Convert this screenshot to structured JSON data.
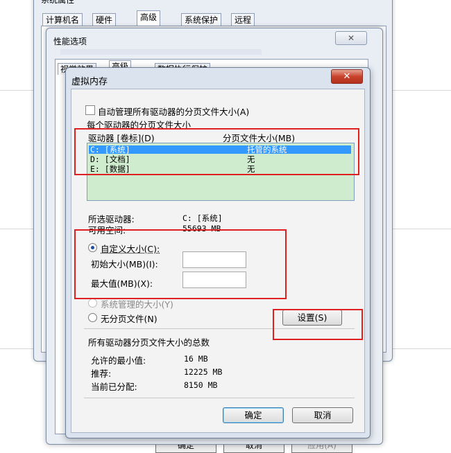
{
  "system_properties": {
    "title": "系统属性",
    "tabs": [
      "计算机名",
      "硬件",
      "高级",
      "系统保护",
      "远程"
    ],
    "buttons": {
      "ok": "确定",
      "cancel": "取消",
      "apply": "应用(A)"
    }
  },
  "performance_options": {
    "title": "性能选项",
    "tabs": [
      "视觉效果",
      "高级",
      "数据执行保护"
    ]
  },
  "virtual_memory": {
    "title": "虚拟内存",
    "close_glyph": "✕",
    "auto_manage_label": "自动管理所有驱动器的分页文件大小(A)",
    "section_label": "每个驱动器的分页文件大小",
    "list_headers": {
      "drive": "驱动器 [卷标](D)",
      "size": "分页文件大小(MB)"
    },
    "drives": [
      {
        "drive": "C:   [系统]",
        "size": "托管的系统",
        "selected": true
      },
      {
        "drive": "D:   [文档]",
        "size": "无",
        "selected": false
      },
      {
        "drive": "E:   [数据]",
        "size": "无",
        "selected": false
      }
    ],
    "selected_drive_label": "所选驱动器:",
    "selected_drive_value": "C:  [系统]",
    "free_space_label": "可用空间:",
    "free_space_value": "55693 MB",
    "custom_size_label": "自定义大小(C):",
    "initial_size_label": "初始大小(MB)(I):",
    "initial_size_value": "",
    "max_size_label": "最大值(MB)(X):",
    "max_size_value": "",
    "system_managed_label": "系统管理的大小(Y)",
    "no_paging_label": "无分页文件(N)",
    "set_button": "设置(S)",
    "total_section_label": "所有驱动器分页文件大小的总数",
    "min_allowed_label": "允许的最小值:",
    "min_allowed_value": "16 MB",
    "recommended_label": "推荐:",
    "recommended_value": "12225 MB",
    "current_allocated_label": "当前已分配:",
    "current_allocated_value": "8150 MB",
    "ok_button": "确定",
    "cancel_button": "取消"
  },
  "annotation_color": "#e02020"
}
